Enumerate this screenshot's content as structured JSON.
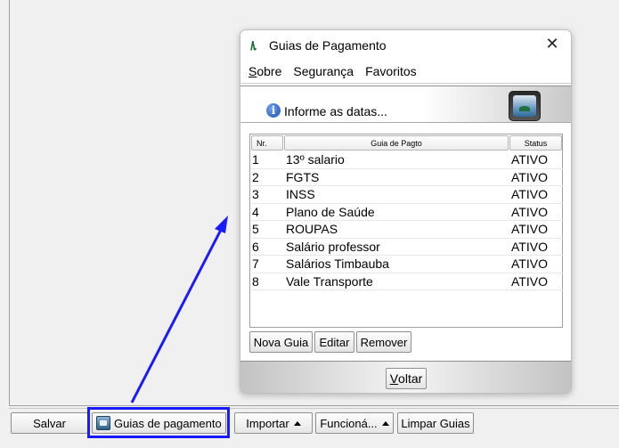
{
  "toolbar": {
    "salvar_label": "Salvar",
    "guias_label": "Guias de pagamento",
    "importar_label": "Importar",
    "funciona_label": "Funcioná...",
    "limpar_label": "Limpar Guias"
  },
  "dialog": {
    "title": "Guias de Pagamento",
    "menu": [
      {
        "label_underlined": "S",
        "label_rest": "obre"
      },
      {
        "label": "Segurança"
      },
      {
        "label": "Favoritos"
      }
    ],
    "info_text": "Informe as datas...",
    "table": {
      "headers": {
        "nr": "Nr.",
        "guia": "Guia de Pagto",
        "status": "Status"
      },
      "rows": [
        {
          "nr": "1",
          "guia": "13º salario",
          "status": "ATIVO"
        },
        {
          "nr": "2",
          "guia": "FGTS",
          "status": "ATIVO"
        },
        {
          "nr": "3",
          "guia": "INSS",
          "status": "ATIVO"
        },
        {
          "nr": "4",
          "guia": "Plano de Saúde",
          "status": "ATIVO"
        },
        {
          "nr": "5",
          "guia": "ROUPAS",
          "status": "ATIVO"
        },
        {
          "nr": "6",
          "guia": "Salário professor",
          "status": "ATIVO"
        },
        {
          "nr": "7",
          "guia": "Salários Timbauba",
          "status": "ATIVO"
        },
        {
          "nr": "8",
          "guia": "Vale Transporte",
          "status": "ATIVO"
        }
      ]
    },
    "buttons": {
      "nova": "Nova Guia",
      "editar": "Editar",
      "remover": "Remover",
      "voltar_underlined": "V",
      "voltar_rest": "oltar"
    }
  },
  "colors": {
    "highlight": "#1a1aff",
    "arrow": "#1a1aff"
  }
}
